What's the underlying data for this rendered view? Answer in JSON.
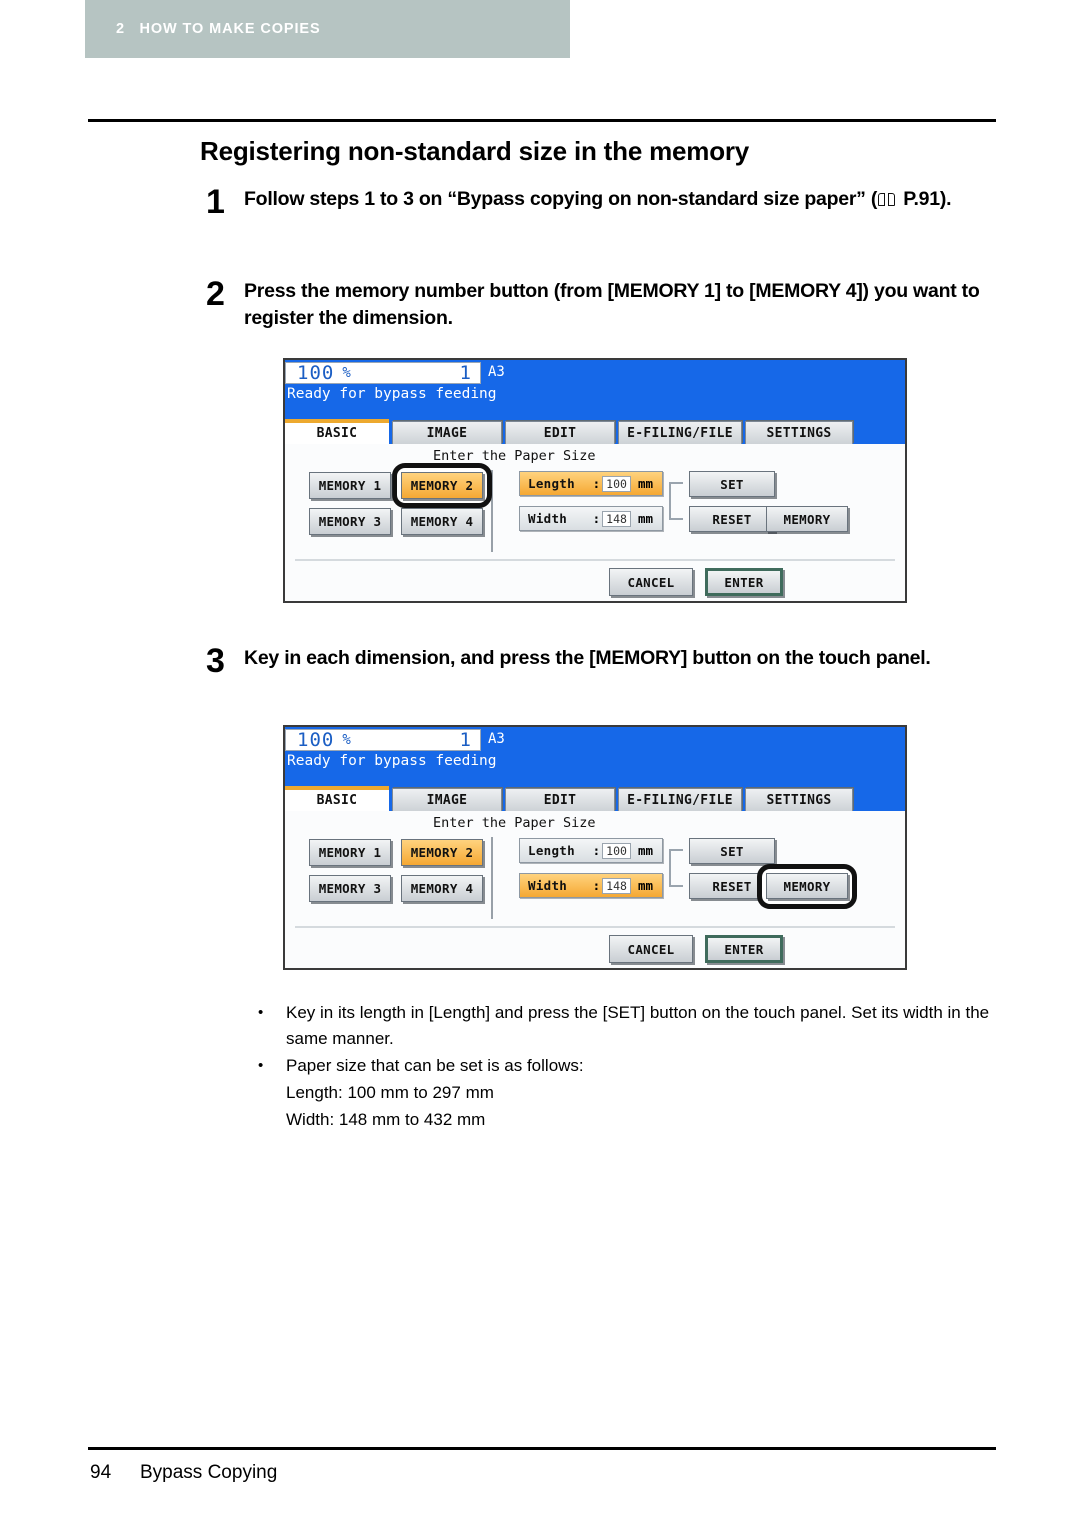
{
  "chapter": {
    "number": "2",
    "title": "HOW TO MAKE COPIES"
  },
  "section_title": "Registering non-standard size in the memory",
  "steps": [
    {
      "number": "1",
      "text_before": "Follow steps 1 to 3 on “Bypass copying on non-standard size paper” (",
      "icon": "book-icon",
      "text_after": " P.91)."
    },
    {
      "number": "2",
      "text": "Press the memory number button (from [MEMORY 1] to [MEMORY 4]) you want to register the dimension."
    },
    {
      "number": "3",
      "text": "Key in each dimension, and press the [MEMORY] button on the touch panel."
    }
  ],
  "panel1": {
    "zoom_value": "100",
    "zoom_percent": "%",
    "copies": "1",
    "paper_size": "A3",
    "status": "Ready for bypass feeding",
    "tabs": [
      {
        "label": "BASIC",
        "active": true
      },
      {
        "label": "IMAGE",
        "active": false
      },
      {
        "label": "EDIT",
        "active": false
      },
      {
        "label": "E-FILING/FILE",
        "active": false
      },
      {
        "label": "SETTINGS",
        "active": false
      }
    ],
    "hint": "Enter the Paper Size",
    "memory_buttons": [
      {
        "label": "MEMORY 1",
        "highlighted": false,
        "selected": false
      },
      {
        "label": "MEMORY 2",
        "highlighted": true,
        "selected": true
      },
      {
        "label": "MEMORY 3",
        "highlighted": false,
        "selected": false
      },
      {
        "label": "MEMORY 4",
        "highlighted": false,
        "selected": false
      }
    ],
    "length": {
      "label": "Length",
      "colon": ":",
      "value": "100",
      "unit": "mm",
      "highlighted": true
    },
    "width": {
      "label": "Width",
      "colon": ":",
      "value": "148",
      "unit": "mm",
      "highlighted": false
    },
    "set_label": "SET",
    "reset_label": "RESET",
    "memory_label": "MEMORY",
    "memory_selected": false,
    "cancel_label": "CANCEL",
    "enter_label": "ENTER"
  },
  "panel2": {
    "zoom_value": "100",
    "zoom_percent": "%",
    "copies": "1",
    "paper_size": "A3",
    "status": "Ready for bypass feeding",
    "tabs": [
      {
        "label": "BASIC",
        "active": true
      },
      {
        "label": "IMAGE",
        "active": false
      },
      {
        "label": "EDIT",
        "active": false
      },
      {
        "label": "E-FILING/FILE",
        "active": false
      },
      {
        "label": "SETTINGS",
        "active": false
      }
    ],
    "hint": "Enter the Paper Size",
    "memory_buttons": [
      {
        "label": "MEMORY 1",
        "highlighted": false,
        "selected": false
      },
      {
        "label": "MEMORY 2",
        "highlighted": true,
        "selected": false
      },
      {
        "label": "MEMORY 3",
        "highlighted": false,
        "selected": false
      },
      {
        "label": "MEMORY 4",
        "highlighted": false,
        "selected": false
      }
    ],
    "length": {
      "label": "Length",
      "colon": ":",
      "value": "100",
      "unit": "mm",
      "highlighted": false
    },
    "width": {
      "label": "Width",
      "colon": ":",
      "value": "148",
      "unit": "mm",
      "highlighted": true
    },
    "set_label": "SET",
    "reset_label": "RESET",
    "memory_label": "MEMORY",
    "memory_selected": true,
    "cancel_label": "CANCEL",
    "enter_label": "ENTER"
  },
  "notes": [
    {
      "bullet": "•",
      "text": "Key in its length in [Length] and press the [SET] button on the touch panel. Set its width in the same manner."
    },
    {
      "bullet": "•",
      "text": "Paper size that can be set is as follows:"
    },
    {
      "bullet": "",
      "text": "Length: 100 mm to 297 mm"
    },
    {
      "bullet": "",
      "text": "Width: 148 mm to 432 mm"
    }
  ],
  "footer": {
    "page_number": "94",
    "label": "Bypass Copying"
  },
  "colors": {
    "chapter_bar": "#b6c4c2",
    "lcd_blue": "#1668e8",
    "highlight_orange": "#f5a833",
    "active_tab_accent": "#eda92f",
    "enter_outline": "#3f6b5c"
  }
}
